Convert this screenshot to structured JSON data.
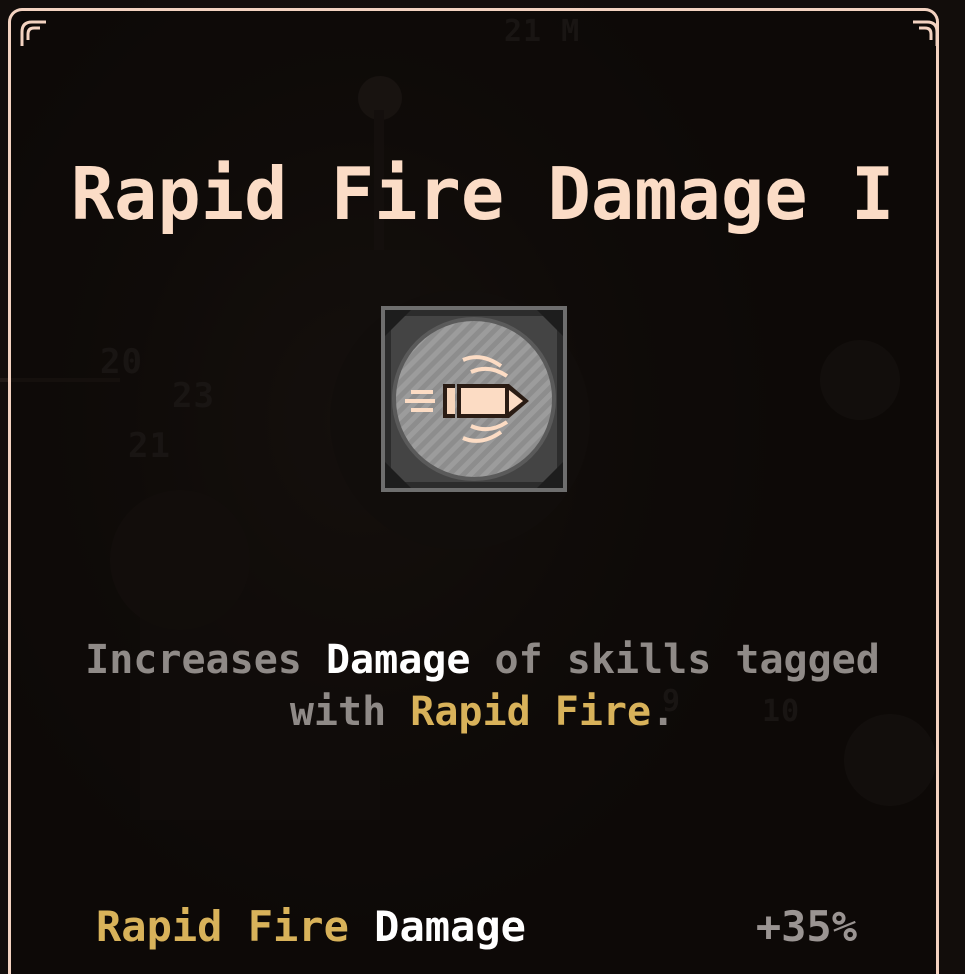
{
  "tooltip": {
    "title": "Rapid Fire Damage I",
    "icon": "rapid-fire-bullet-icon",
    "description": {
      "part1": "Increases ",
      "keyword1": "Damage",
      "part2": " of skills tagged with ",
      "keyword2": "Rapid Fire",
      "part3": "."
    },
    "stat": {
      "tag": "Rapid Fire",
      "name": "Damage",
      "value": "+35%"
    }
  },
  "background": {
    "labels": [
      "21 M",
      "20",
      "23",
      "21",
      "9",
      "10"
    ]
  },
  "colors": {
    "frame": "#f3d2c0",
    "title": "#fbdcc6",
    "gold": "#d8b25a",
    "white": "#ffffff",
    "gray": "#8f8a87"
  }
}
